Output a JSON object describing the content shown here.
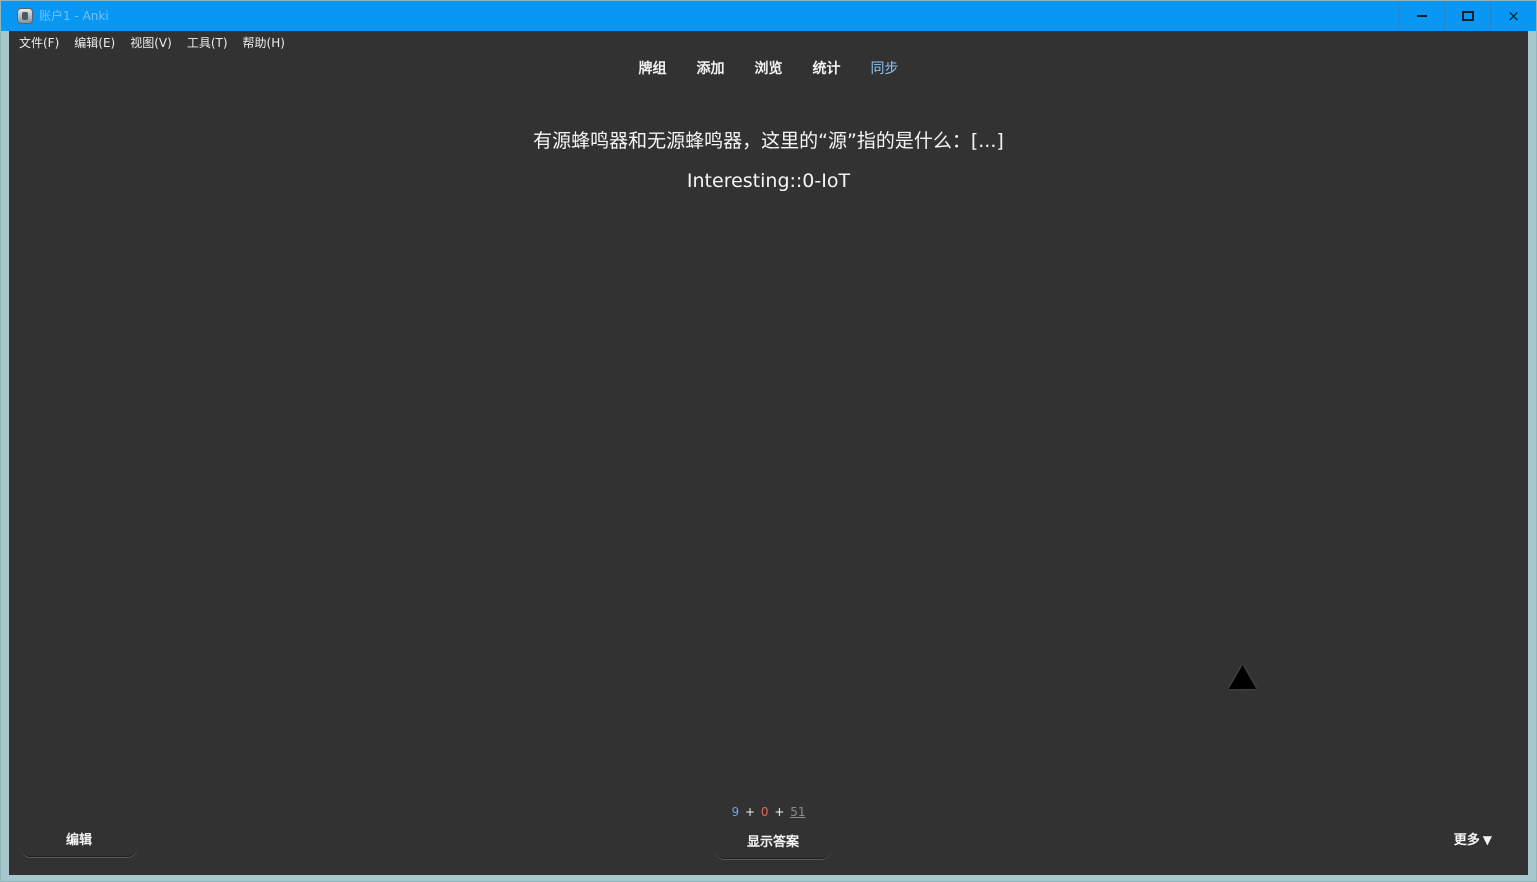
{
  "window": {
    "title": "账户1 - Anki",
    "minimize_label": "",
    "maximize_label": "",
    "close_label": "×"
  },
  "menubar": {
    "items": [
      "文件(F)",
      "编辑(E)",
      "视图(V)",
      "工具(T)",
      "帮助(H)"
    ]
  },
  "toolbar": {
    "items": [
      "牌组",
      "添加",
      "浏览",
      "统计",
      "同步"
    ]
  },
  "card": {
    "question": "有源蜂鸣器和无源蜂鸣器，这里的“源”指的是什么：[...]",
    "deck": "Interesting::0-IoT"
  },
  "bottom": {
    "counts": {
      "new": "9",
      "learn": "0",
      "review": "51",
      "plus": "+"
    },
    "edit_label": "编辑",
    "show_answer_label": "显示答案",
    "more_label": "更多",
    "more_arrow": "▼"
  },
  "colors": {
    "titlebar": "#0897f5",
    "background": "#323232",
    "sync": "#8bc4f7",
    "new_count": "#66a8f1",
    "learn_count": "#e06b5d",
    "review_count": "#8c8c8c"
  }
}
